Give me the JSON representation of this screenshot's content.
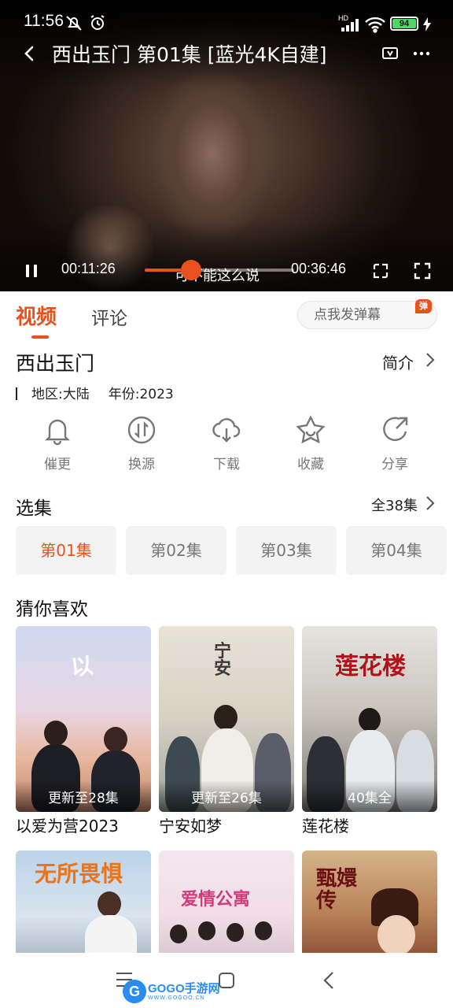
{
  "status_bar": {
    "time": "11:56",
    "network": "HD",
    "battery": "94",
    "battery_level": 0.94
  },
  "player": {
    "title": "西出玉门  第01集  [蓝光4K自建]",
    "subtitle": "可不能这么说",
    "current_time": "00:11:26",
    "duration": "00:36:46",
    "progress": 0.31,
    "icons": [
      "back-icon",
      "cast-tv-icon",
      "more-icon",
      "pause-icon",
      "rotate-icon",
      "fullscreen-icon"
    ]
  },
  "tabs": {
    "video": "视频",
    "comments": "评论",
    "danmu_placeholder": "点我发弹幕",
    "danmu_badge": "弹"
  },
  "show": {
    "title": "西出玉门",
    "intro_label": "简介",
    "region_label": "地区:",
    "region": "大陆",
    "year_label": "年份:",
    "year": "2023"
  },
  "actions": [
    {
      "label": "催更",
      "icon": "bell-icon"
    },
    {
      "label": "换源",
      "icon": "switch-source-icon"
    },
    {
      "label": "下载",
      "icon": "download-icon"
    },
    {
      "label": "收藏",
      "icon": "star-icon"
    },
    {
      "label": "分享",
      "icon": "share-icon"
    }
  ],
  "episodes": {
    "title": "选集",
    "total_label": "全38集",
    "items": [
      "第01集",
      "第02集",
      "第03集",
      "第04集"
    ],
    "selected": "第01集"
  },
  "recommend": {
    "title": "猜你喜欢",
    "items": [
      {
        "name": "以爱为营2023",
        "badge": "更新至28集"
      },
      {
        "name": "宁安如梦",
        "badge": "更新至26集"
      },
      {
        "name": "莲花楼",
        "badge": "40集全"
      }
    ],
    "row2": [
      "无所畏惧",
      "爱情公寓",
      "甄嬛传"
    ]
  },
  "watermark": {
    "logo": "G",
    "text": "GOGO手游网",
    "url": "WWW.GOGOO.CN"
  },
  "colors": {
    "accent": "#e8511c",
    "text": "#111111",
    "muted": "#777777",
    "chip_bg": "#f3f3f3"
  }
}
